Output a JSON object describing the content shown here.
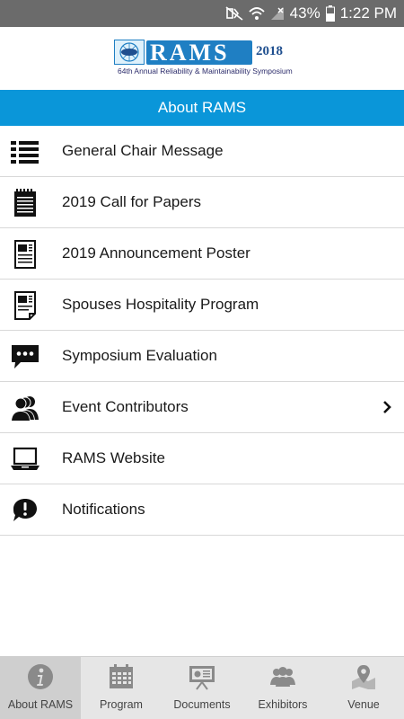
{
  "status_bar": {
    "battery": "43%",
    "time": "1:22 PM"
  },
  "logo": {
    "name": "RAMS",
    "year": "2018",
    "subtitle": "64th Annual Reliability & Maintainability Symposium"
  },
  "title_bar": {
    "title": "About RAMS"
  },
  "menu": {
    "items": [
      {
        "label": "General Chair Message",
        "icon": "list-icon"
      },
      {
        "label": "2019 Call for Papers",
        "icon": "notepad-icon"
      },
      {
        "label": "2019 Announcement Poster",
        "icon": "document-icon"
      },
      {
        "label": "Spouses Hospitality Program",
        "icon": "document-icon"
      },
      {
        "label": "Symposium Evaluation",
        "icon": "chat-bubble-icon"
      },
      {
        "label": "Event Contributors",
        "icon": "people-icon",
        "has_chevron": true
      },
      {
        "label": "RAMS Website",
        "icon": "laptop-icon"
      },
      {
        "label": "Notifications",
        "icon": "alert-bubble-icon"
      }
    ]
  },
  "tabs": [
    {
      "label": "About RAMS",
      "icon": "info-icon",
      "active": true
    },
    {
      "label": "Program",
      "icon": "calendar-icon",
      "active": false
    },
    {
      "label": "Documents",
      "icon": "presentation-icon",
      "active": false
    },
    {
      "label": "Exhibitors",
      "icon": "group-icon",
      "active": false
    },
    {
      "label": "Venue",
      "icon": "map-pin-icon",
      "active": false
    }
  ],
  "colors": {
    "title_bar": "#0a96d9",
    "status_bar": "#6b6b6b",
    "tab_bar": "#e6e6e6",
    "tab_active": "#cfcfcf"
  }
}
